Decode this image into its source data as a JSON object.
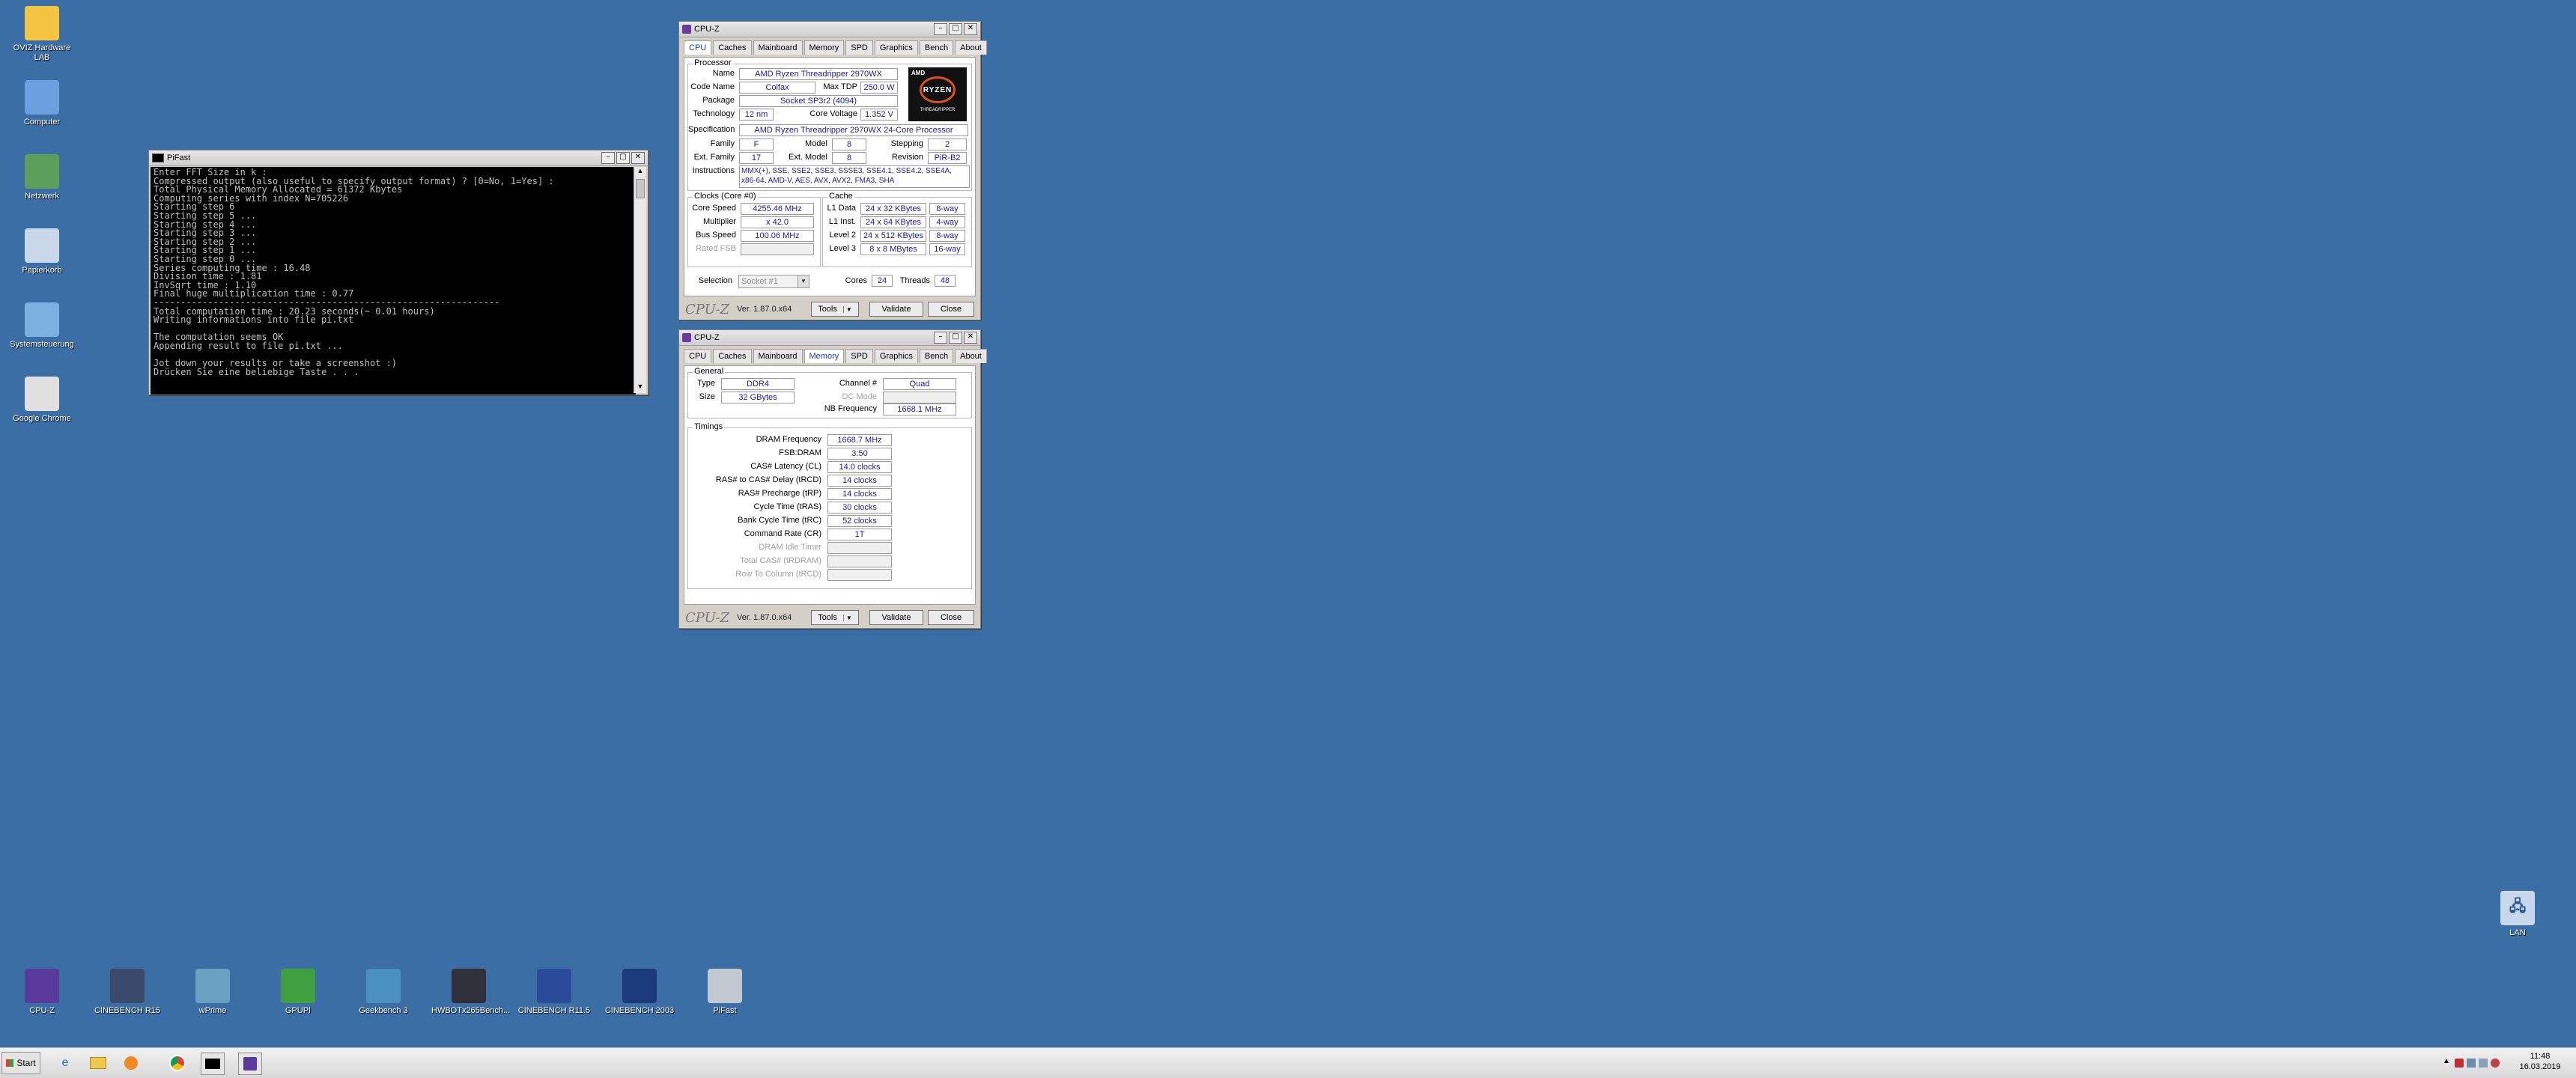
{
  "desktop_icons_left": [
    {
      "label": "OVIZ Hardware LAB",
      "icon": "folder-icon",
      "color": "#f5c542"
    },
    {
      "label": "Computer",
      "icon": "computer-icon",
      "color": "#6aa0e0"
    },
    {
      "label": "Netzwerk",
      "icon": "network-icon",
      "color": "#5aa05a"
    },
    {
      "label": "Papierkorb",
      "icon": "recycle-bin-icon",
      "color": "#c8d8e8"
    },
    {
      "label": "Systemsteuerung",
      "icon": "control-panel-icon",
      "color": "#7cb0e0"
    },
    {
      "label": "Google Chrome",
      "icon": "chrome-icon",
      "color": "#e0e0e0"
    }
  ],
  "desktop_icons_bottom": [
    {
      "label": "CPU-Z",
      "icon": "cpuz-icon",
      "color": "#5a3a9a"
    },
    {
      "label": "CINEBENCH R15",
      "icon": "cinebench-icon",
      "color": "#3a4a6a"
    },
    {
      "label": "wPrime",
      "icon": "wprime-icon",
      "color": "#6aa0c0"
    },
    {
      "label": "GPUPI",
      "icon": "gpupi-icon",
      "color": "#40a040"
    },
    {
      "label": "Geekbench 3",
      "icon": "geekbench-icon",
      "color": "#4a90c0"
    },
    {
      "label": "HWBOTx265Bench...",
      "icon": "hwbot-icon",
      "color": "#30303a"
    },
    {
      "label": "CINEBENCH R11.5",
      "icon": "cinebench-icon",
      "color": "#2a4a9a"
    },
    {
      "label": "CINEBENCH 2003",
      "icon": "cinebench-icon",
      "color": "#1a3a7a"
    },
    {
      "label": "PiFast",
      "icon": "pifast-icon",
      "color": "#c0c8d0"
    }
  ],
  "lan_icon": {
    "label": "LAN"
  },
  "pifast": {
    "title": "PiFast",
    "lines": [
      "Enter FFT Size in k :",
      "Compressed output (also useful to specify output format) ? [0=No, 1=Yes] :",
      "Total Physical Memory Allocated = 61372 Kbytes",
      "Computing series with index N=705226",
      "Starting step 6",
      "Starting step 5 ...",
      "Starting step 4 ...",
      "Starting step 3 ...",
      "Starting step 2 ...",
      "Starting step 1 ...",
      "Starting step 0 ...",
      "Series computing time : 16.48",
      "Division time : 1.81",
      "InvSqrt time : 1.10",
      "Final huge multiplication time : 0.77",
      "----------------------------------------------------------------",
      "Total computation time : 20.23 seconds(~ 0.01 hours)",
      "Writing informations into file pi.txt",
      "",
      "The computation seems OK",
      "Appending result to file pi.txt ...",
      "",
      "Jot down your results or take a screenshot :)",
      "Drücken Sie eine beliebige Taste . . ."
    ]
  },
  "cpuz_cpu": {
    "title": "CPU-Z",
    "tabs": [
      "CPU",
      "Caches",
      "Mainboard",
      "Memory",
      "SPD",
      "Graphics",
      "Bench",
      "About"
    ],
    "processor_group": "Processor",
    "name_label": "Name",
    "name": "AMD Ryzen Threadripper 2970WX",
    "codename_label": "Code Name",
    "codename": "Colfax",
    "tdp_label": "Max TDP",
    "tdp": "250.0 W",
    "package_label": "Package",
    "package": "Socket SP3r2 (4094)",
    "technology_label": "Technology",
    "technology": "12 nm",
    "voltage_label": "Core Voltage",
    "voltage": "1.352 V",
    "spec_label": "Specification",
    "spec": "AMD Ryzen Threadripper 2970WX 24-Core Processor",
    "family_label": "Family",
    "family": "F",
    "model_label": "Model",
    "model": "8",
    "stepping_label": "Stepping",
    "stepping": "2",
    "extfamily_label": "Ext. Family",
    "extfamily": "17",
    "extmodel_label": "Ext. Model",
    "extmodel": "8",
    "revision_label": "Revision",
    "revision": "PiR-B2",
    "instructions_label": "Instructions",
    "instructions_1": "MMX(+), SSE, SSE2, SSE3, SSSE3, SSE4.1, SSE4.2, SSE4A,",
    "instructions_2": "x86-64, AMD-V, AES, AVX, AVX2, FMA3, SHA",
    "logo_top": "AMD",
    "logo_main": "RYZEN",
    "logo_sub": "THREADRIPPER",
    "clocks_group": "Clocks (Core #0)",
    "corespeed_label": "Core Speed",
    "corespeed": "4255.46 MHz",
    "multiplier_label": "Multiplier",
    "multiplier": "x 42.0",
    "busspeed_label": "Bus Speed",
    "busspeed": "100.06 MHz",
    "ratedfsb_label": "Rated FSB",
    "ratedfsb": "",
    "cache_group": "Cache",
    "l1d_label": "L1 Data",
    "l1d": "24 x 32 KBytes",
    "l1d_way": "8-way",
    "l1i_label": "L1 Inst.",
    "l1i": "24 x 64 KBytes",
    "l1i_way": "4-way",
    "l2_label": "Level 2",
    "l2": "24 x 512 KBytes",
    "l2_way": "8-way",
    "l3_label": "Level 3",
    "l3": "8 x 8 MBytes",
    "l3_way": "16-way",
    "selection_label": "Selection",
    "selection": "Socket #1",
    "cores_label": "Cores",
    "cores": "24",
    "threads_label": "Threads",
    "threads": "48",
    "brand": "CPU-Z",
    "version": "Ver. 1.87.0.x64",
    "tools": "Tools",
    "validate": "Validate",
    "close": "Close"
  },
  "cpuz_mem": {
    "title": "CPU-Z",
    "tabs": [
      "CPU",
      "Caches",
      "Mainboard",
      "Memory",
      "SPD",
      "Graphics",
      "Bench",
      "About"
    ],
    "general_group": "General",
    "type_label": "Type",
    "type": "DDR4",
    "channel_label": "Channel #",
    "channel": "Quad",
    "size_label": "Size",
    "size": "32 GBytes",
    "dcmode_label": "DC Mode",
    "dcmode": "",
    "nbfreq_label": "NB Frequency",
    "nbfreq": "1668.1 MHz",
    "timings_group": "Timings",
    "timings": [
      {
        "label": "DRAM Frequency",
        "value": "1668.7 MHz",
        "disabled": false
      },
      {
        "label": "FSB:DRAM",
        "value": "3:50",
        "disabled": false
      },
      {
        "label": "CAS# Latency (CL)",
        "value": "14.0 clocks",
        "disabled": false
      },
      {
        "label": "RAS# to CAS# Delay (tRCD)",
        "value": "14 clocks",
        "disabled": false
      },
      {
        "label": "RAS# Precharge (tRP)",
        "value": "14 clocks",
        "disabled": false
      },
      {
        "label": "Cycle Time (tRAS)",
        "value": "30 clocks",
        "disabled": false
      },
      {
        "label": "Bank Cycle Time (tRC)",
        "value": "52 clocks",
        "disabled": false
      },
      {
        "label": "Command Rate (CR)",
        "value": "1T",
        "disabled": false
      },
      {
        "label": "DRAM Idle Timer",
        "value": "",
        "disabled": true
      },
      {
        "label": "Total CAS# (tRDRAM)",
        "value": "",
        "disabled": true
      },
      {
        "label": "Row To Column (tRCD)",
        "value": "",
        "disabled": true
      }
    ],
    "brand": "CPU-Z",
    "version": "Ver. 1.87.0.x64",
    "tools": "Tools",
    "validate": "Validate",
    "close": "Close"
  },
  "taskbar": {
    "start": "Start",
    "time": "11:48",
    "date": "16.03.2019"
  }
}
